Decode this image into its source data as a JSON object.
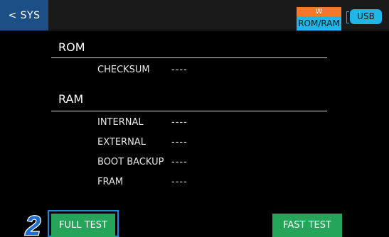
{
  "header": {
    "back_label": "< SYS",
    "status_top": "W",
    "status_bottom": "ROM/RAM",
    "usb_label": "USB"
  },
  "rom": {
    "title": "ROM",
    "items": [
      {
        "label": "CHECKSUM",
        "value": "----"
      }
    ]
  },
  "ram": {
    "title": "RAM",
    "items": [
      {
        "label": "INTERNAL",
        "value": "----"
      },
      {
        "label": "EXTERNAL",
        "value": "----"
      },
      {
        "label": "BOOT BACKUP",
        "value": "----"
      },
      {
        "label": "FRAM",
        "value": "----"
      }
    ]
  },
  "actions": {
    "full_test_label": "FULL TEST",
    "fast_test_label": "FAST TEST"
  },
  "annotation": {
    "step_number": "2"
  },
  "colors": {
    "accent_blue": "#1d4f87",
    "status_orange": "#f07a2f",
    "status_cyan": "#1fb7e9",
    "button_green": "#25a55a",
    "highlight_blue": "#1f8bd6"
  }
}
